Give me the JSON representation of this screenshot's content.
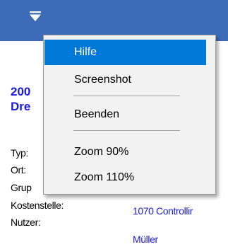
{
  "header": {
    "menu_icon": "menu-triangle-icon",
    "background_color": "#3d6bb8"
  },
  "record": {
    "title_line1": "200",
    "title_line2": "Dre",
    "fields": [
      {
        "label": "Typ:",
        "value": ""
      },
      {
        "label": "Ort:",
        "value": ""
      },
      {
        "label": "Grup",
        "value": ""
      },
      {
        "label": "Kostenstelle:",
        "value": "1070 Controllir"
      },
      {
        "label": "Nutzer:",
        "value": "Müller"
      }
    ]
  },
  "menu": {
    "items": [
      {
        "label": "Hilfe",
        "highlighted": true
      },
      {
        "label": "Screenshot"
      },
      {
        "label": "Beenden"
      },
      {
        "label": "Zoom 90%"
      },
      {
        "label": "Zoom 110%"
      }
    ],
    "highlight_color": "#0078d7"
  }
}
